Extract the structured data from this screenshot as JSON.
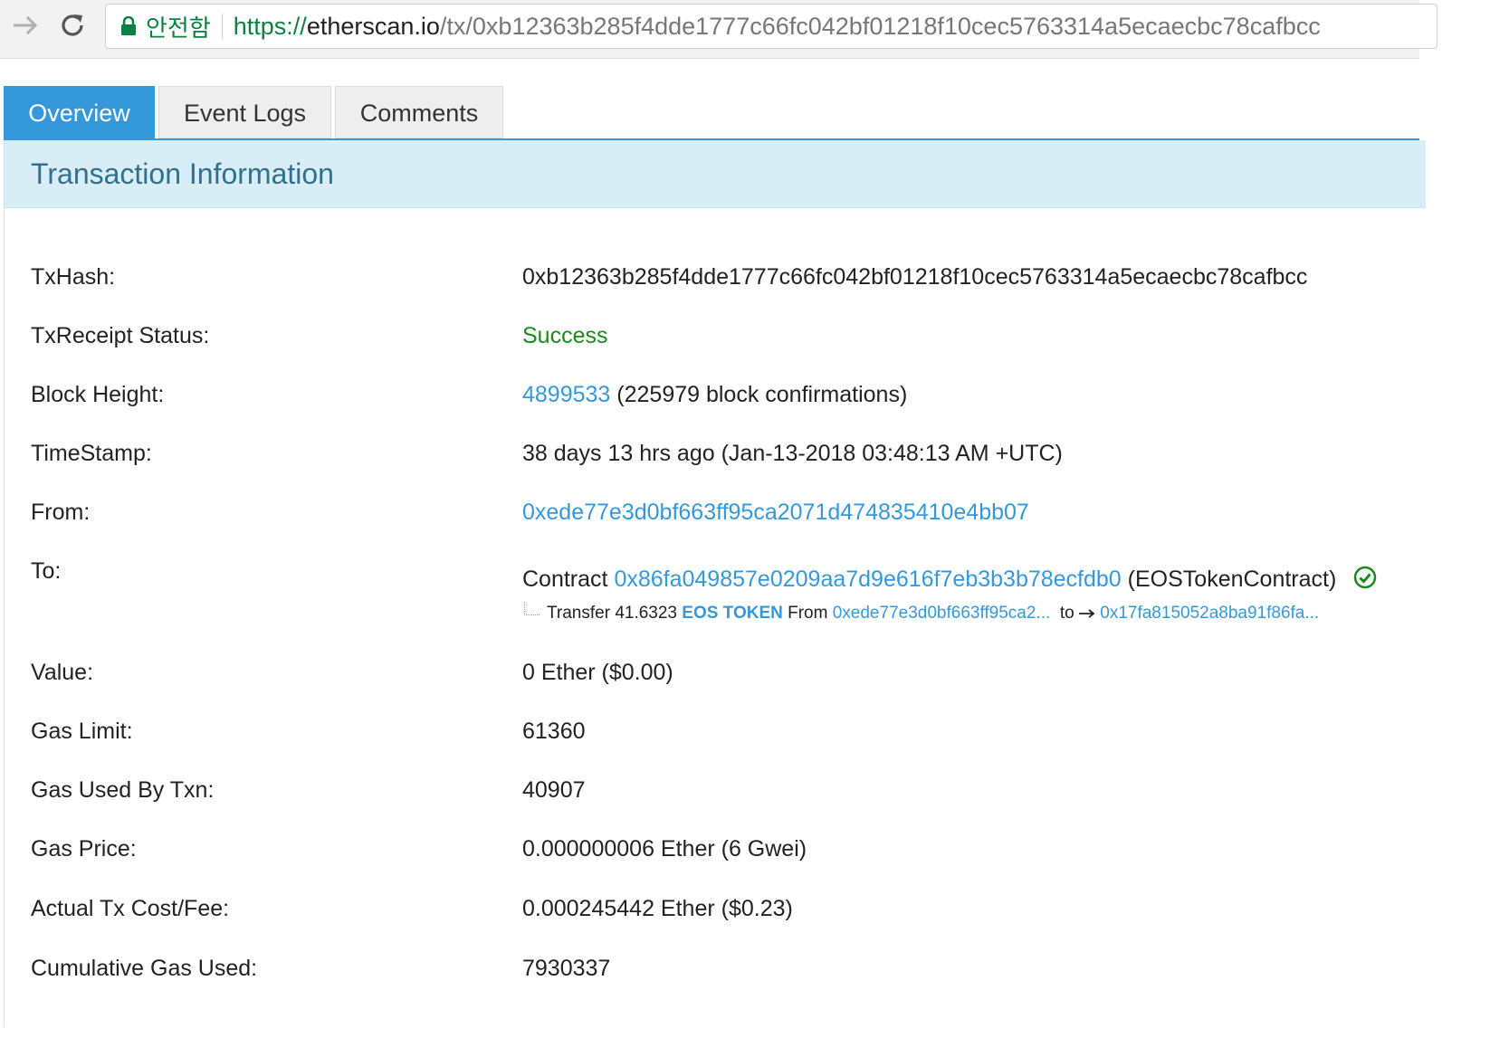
{
  "browser": {
    "secure_label": "안전함",
    "url_scheme": "https://",
    "url_host": "etherscan.io",
    "url_path": "/tx/0xb12363b285f4dde1777c66fc042bf01218f10cec5763314a5ecaecbc78cafbcc"
  },
  "tabs": [
    {
      "label": "Overview",
      "active": true
    },
    {
      "label": "Event Logs",
      "active": false
    },
    {
      "label": "Comments",
      "active": false
    }
  ],
  "panel": {
    "title": "Transaction Information"
  },
  "fields": {
    "txhash": {
      "label": "TxHash:",
      "value": "0xb12363b285f4dde1777c66fc042bf01218f10cec5763314a5ecaecbc78cafbcc"
    },
    "status": {
      "label": "TxReceipt Status:",
      "value": "Success"
    },
    "block": {
      "label": "Block Height:",
      "number": "4899533",
      "confirmations": "(225979 block confirmations)"
    },
    "timestamp": {
      "label": "TimeStamp:",
      "value": "38 days 13 hrs ago (Jan-13-2018 03:48:13 AM +UTC)"
    },
    "from": {
      "label": "From:",
      "value": "0xede77e3d0bf663ff95ca2071d474835410e4bb07"
    },
    "to": {
      "label": "To:",
      "prefix": "Contract",
      "address": "0x86fa049857e0209aa7d9e616f7eb3b3b78ecfdb0",
      "name": "(EOSTokenContract)",
      "transfer": {
        "prefix": "Transfer 41.6323",
        "token": "EOS TOKEN",
        "from_word": "From",
        "from_address": "0xede77e3d0bf663ff95ca2...",
        "to_word": "to",
        "to_address": "0x17fa815052a8ba91f86fa..."
      }
    },
    "value": {
      "label": "Value:",
      "value": "0 Ether ($0.00)"
    },
    "gas_limit": {
      "label": "Gas Limit:",
      "value": "61360"
    },
    "gas_used": {
      "label": "Gas Used By Txn:",
      "value": "40907"
    },
    "gas_price": {
      "label": "Gas Price:",
      "value": "0.000000006 Ether (6 Gwei)"
    },
    "fee": {
      "label": "Actual Tx Cost/Fee:",
      "value": "0.000245442 Ether ($0.23)"
    },
    "cumulative": {
      "label": "Cumulative Gas Used:",
      "value": "7930337"
    }
  },
  "colors": {
    "accent": "#3498db",
    "success": "#1a8a1a",
    "heading_bg": "#d9edf7",
    "heading_text": "#31708f"
  }
}
